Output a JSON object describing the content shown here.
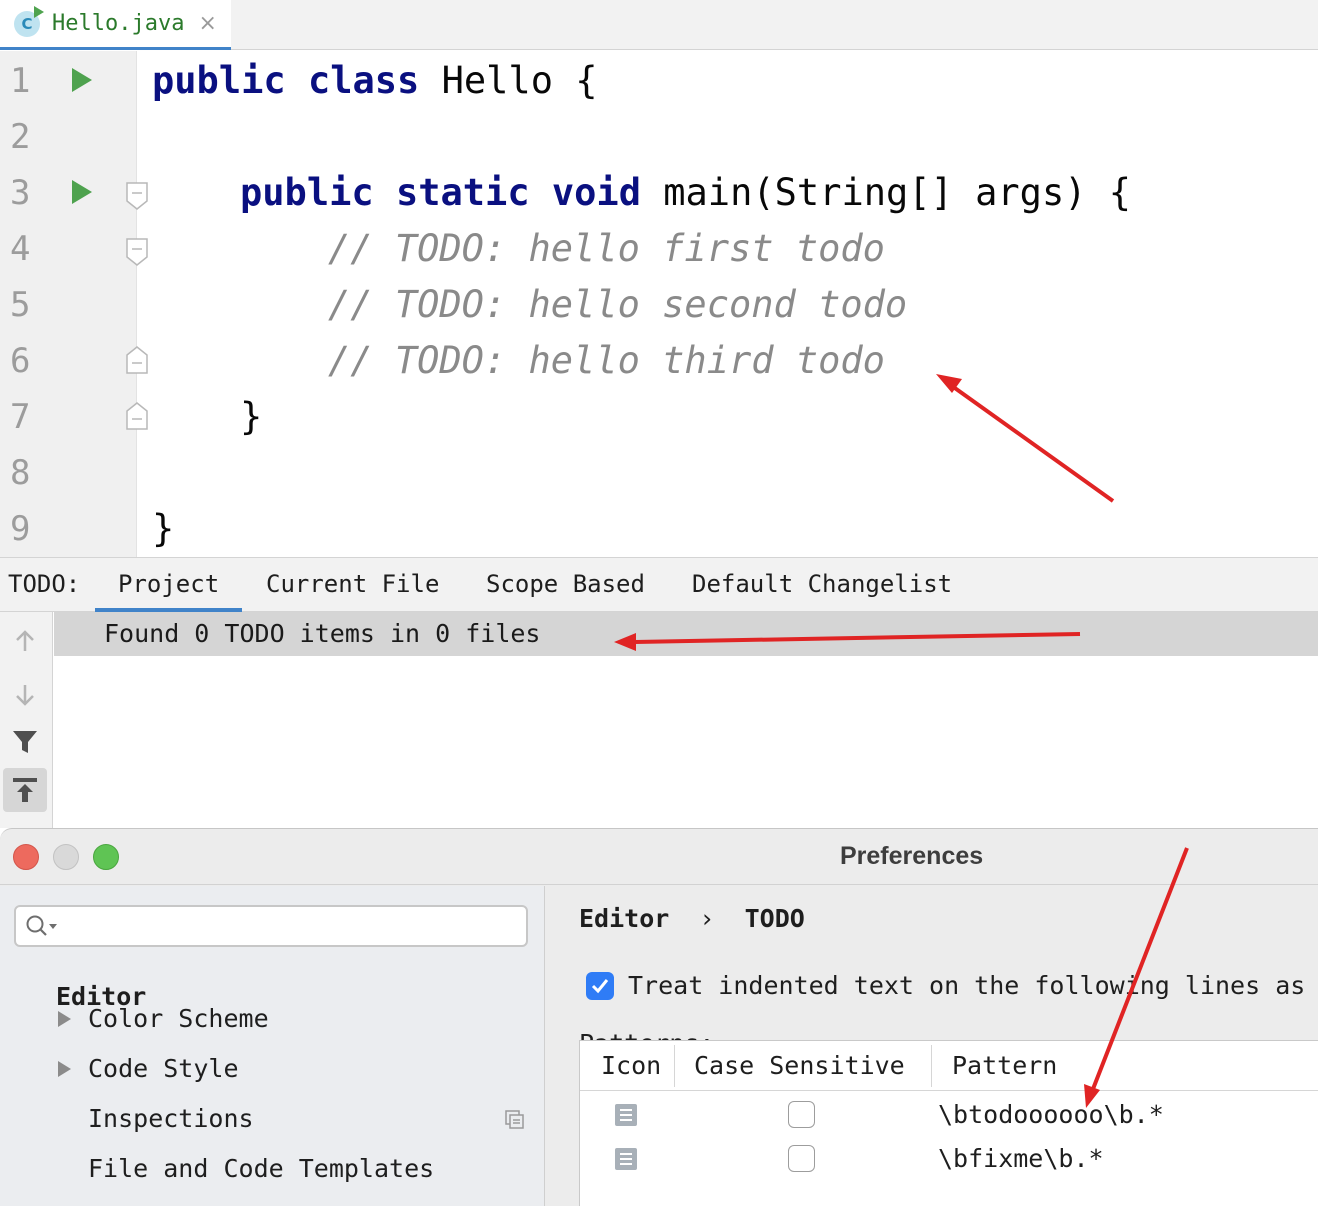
{
  "editor_tab": {
    "label": "Hello.java",
    "close": "×",
    "icon_letter": "C"
  },
  "editor": {
    "line_numbers": [
      "1",
      "2",
      "3",
      "4",
      "5",
      "6",
      "7",
      "8",
      "9"
    ],
    "code": {
      "l1_kw1": "public",
      "l1_kw2": "class",
      "l1_rest": " Hello {",
      "l3_kw1": "public",
      "l3_kw2": "static",
      "l3_kw3": "void",
      "l3_rest": " main(String[] args) {",
      "l4": "// TODO: hello first todo",
      "l5": "// TODO: hello second todo",
      "l6": "// TODO: hello third todo",
      "l7": "}",
      "l9": "}"
    }
  },
  "todo_panel": {
    "title": "TODO:",
    "tabs": [
      "Project",
      "Current File",
      "Scope Based",
      "Default Changelist"
    ],
    "active_tab": "Project",
    "status": "Found 0 TODO items in 0 files"
  },
  "preferences": {
    "title": "Preferences",
    "search_placeholder": "",
    "tree": {
      "section": "Editor",
      "items": [
        "Color Scheme",
        "Code Style",
        "Inspections",
        "File and Code Templates"
      ]
    },
    "breadcrumb": {
      "parent": "Editor",
      "separator": "›",
      "current": "TODO"
    },
    "indent_option": {
      "label": "Treat indented text on the following lines as",
      "checked": true
    },
    "patterns_label": "Patterns:",
    "table": {
      "columns": [
        "Icon",
        "Case Sensitive",
        "Pattern"
      ],
      "rows": [
        {
          "case_sensitive": false,
          "pattern": "\\btodoooooo\\b.*"
        },
        {
          "case_sensitive": false,
          "pattern": "\\bfixme\\b.*"
        }
      ]
    }
  },
  "colors": {
    "keyword": "#0a1080",
    "comment": "#8a8a8a",
    "annotation_arrow": "#e02424",
    "accent": "#4083c9"
  }
}
